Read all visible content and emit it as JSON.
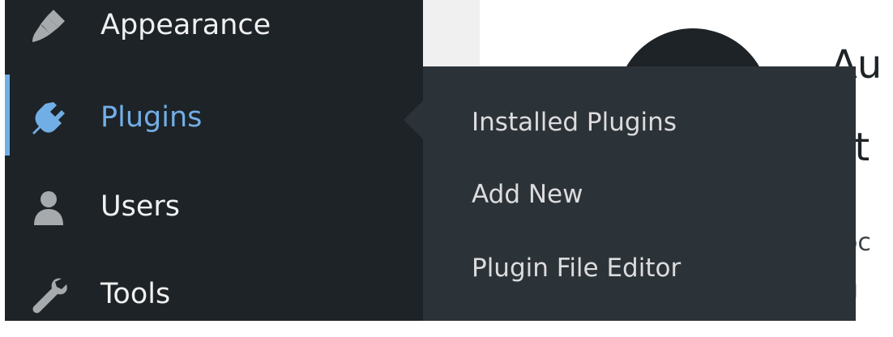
{
  "sidebar": {
    "items": [
      {
        "label": "Appearance",
        "icon": "paintbrush-icon"
      },
      {
        "label": "Plugins",
        "icon": "plugin-icon",
        "active": true
      },
      {
        "label": "Users",
        "icon": "user-icon"
      },
      {
        "label": "Tools",
        "icon": "wrench-icon"
      }
    ],
    "submenu": [
      {
        "label": "Installed Plugins"
      },
      {
        "label": "Add New"
      },
      {
        "label": "Plugin File Editor"
      }
    ]
  },
  "main": {
    "fragments": [
      "Au",
      "at",
      "oc",
      "g"
    ]
  },
  "colors": {
    "sidebar_bg": "#1d2327",
    "submenu_bg": "#2c3338",
    "accent": "#72aee6",
    "text": "#f0f0f1",
    "submenu_text": "#dcdcde"
  }
}
